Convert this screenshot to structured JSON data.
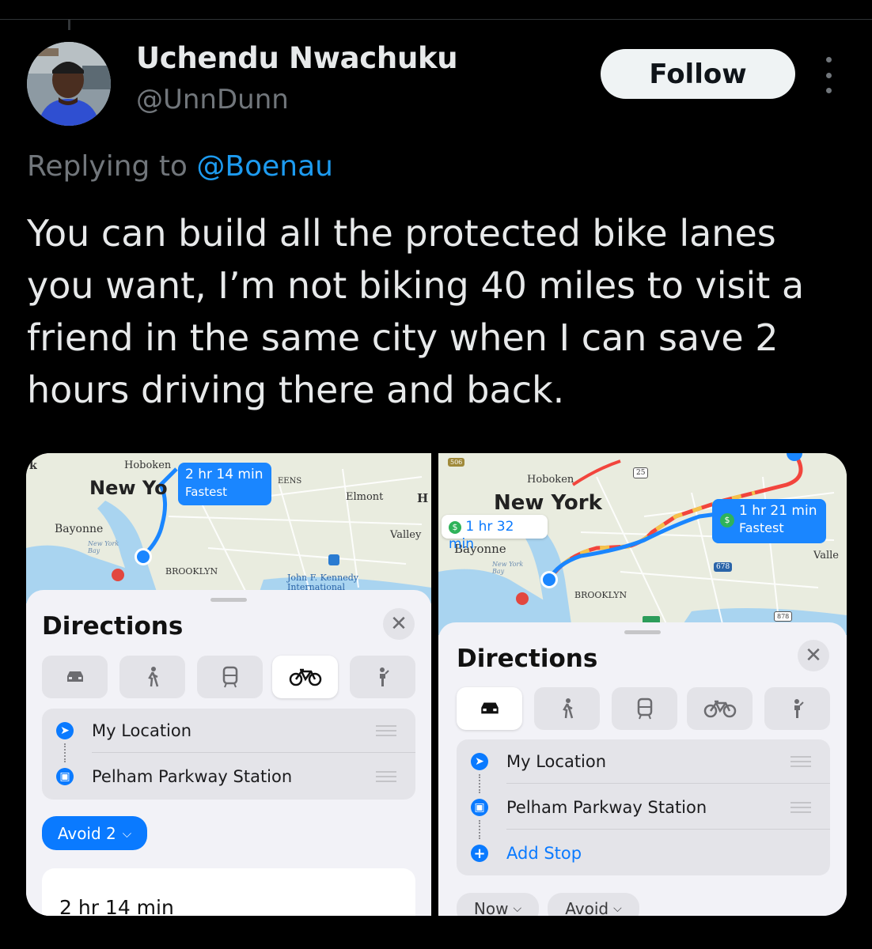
{
  "author": {
    "name": "Uchendu Nwachuku",
    "handle": "@UnnDunn",
    "follow_label": "Follow"
  },
  "reply": {
    "prefix": "Replying to",
    "mention": "@Boenau"
  },
  "tweet_text": "You can build all the protected bike lanes you want, I’m not biking 40 miles to visit a friend in the same city when I can save 2 hours driving there and back.",
  "left_screenshot": {
    "map": {
      "bubble_time": "2 hr 14 min",
      "bubble_sub": "Fastest",
      "labels": {
        "hoboken": "Hoboken",
        "new_york": "New Yo",
        "bayonne": "Bayonne",
        "brooklyn": "BROOKLYN",
        "elmont": "Elmont",
        "valley": "Valley",
        "jfk": "John F. Kennedy International",
        "queens": "EENS",
        "bay": "New York Bay",
        "h": "H",
        "k": "k"
      }
    },
    "title": "Directions",
    "close": "✕",
    "modes": [
      "car",
      "walk",
      "transit",
      "bike",
      "rideshare"
    ],
    "active_mode": "bike",
    "from": "My Location",
    "to": "Pelham Parkway Station",
    "avoid_label": "Avoid 2",
    "result_time": "2 hr 14 min"
  },
  "right_screenshot": {
    "map": {
      "bubble_fast_time": "1 hr 21 min",
      "bubble_fast_sub": "Fastest",
      "bubble_alt_time": "1 hr 32 min",
      "labels": {
        "hoboken": "Hoboken",
        "new_york": "New York",
        "bayonne": "Bayonne",
        "brooklyn": "BROOKLYN",
        "valley": "Valle",
        "bay": "New York Bay",
        "shield_25": "25",
        "shield_678": "678",
        "shield_878": "878",
        "shield_506": "506"
      }
    },
    "title": "Directions",
    "close": "✕",
    "modes": [
      "car",
      "walk",
      "transit",
      "bike",
      "rideshare"
    ],
    "active_mode": "car",
    "from": "My Location",
    "to": "Pelham Parkway Station",
    "add_stop": "Add Stop",
    "now_label": "Now",
    "avoid_label": "Avoid"
  },
  "colors": {
    "accent_blue": "#1d9bf0",
    "ios_blue": "#0a7aff",
    "background": "#000000"
  }
}
